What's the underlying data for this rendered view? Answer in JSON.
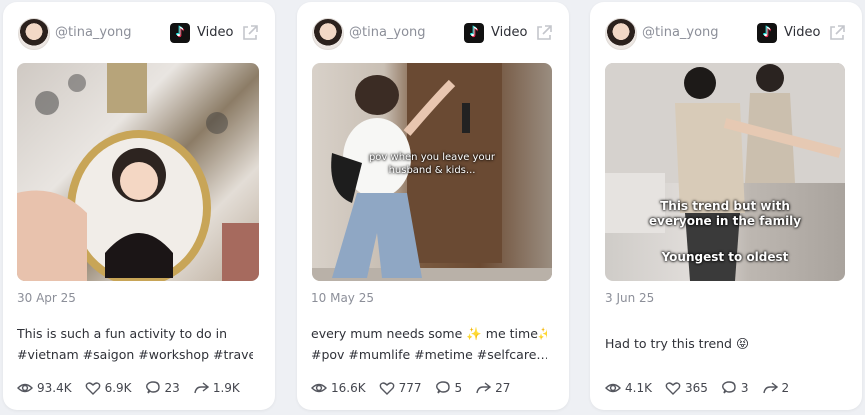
{
  "cards": [
    {
      "handle": "@tina_yong",
      "type_label": "Video",
      "overlay_text": "",
      "overlay_text_2": "",
      "date": "30 Apr 25",
      "caption_line1": "This is such a fun activity to do in",
      "caption_line2": "#vietnam #saigon #workshop #travel…",
      "views": "93.4K",
      "likes": "6.9K",
      "comments": "23",
      "shares": "1.9K"
    },
    {
      "handle": "@tina_yong",
      "type_label": "Video",
      "overlay_text": "pov when you leave your",
      "overlay_text_2": "husband & kids...",
      "date": "10 May 25",
      "caption_line1": "every mum needs some ✨ me time✨",
      "caption_line2": "#pov #mumlife #metime #selfcare…",
      "views": "16.6K",
      "likes": "777",
      "comments": "5",
      "shares": "27"
    },
    {
      "handle": "@tina_yong",
      "type_label": "Video",
      "overlay_text": "This trend but with",
      "overlay_text_2": "everyone in the family",
      "overlay_text_3": "Youngest to oldest",
      "date": "3 Jun 25",
      "caption_line1": "Had to try this trend 😝",
      "caption_line2": "",
      "views": "4.1K",
      "likes": "365",
      "comments": "3",
      "shares": "2"
    }
  ]
}
